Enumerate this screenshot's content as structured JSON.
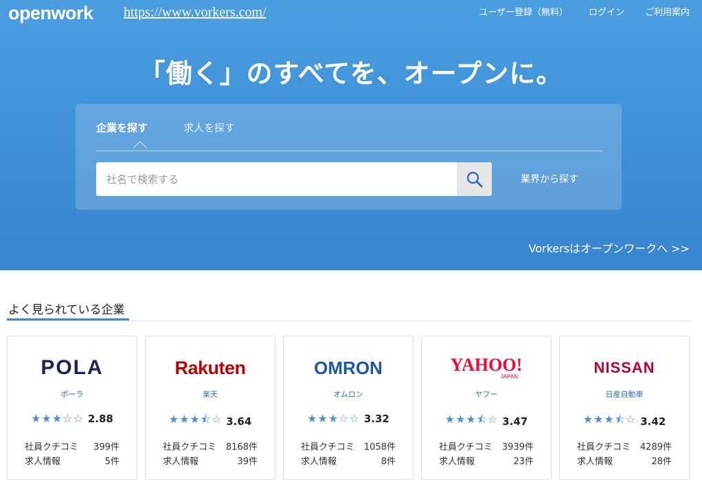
{
  "header": {
    "logo": "openwork",
    "url": "https://www.vorkers.com/",
    "nav": [
      "ユーザー登録（無料）",
      "ログイン",
      "ご利用案内"
    ]
  },
  "hero": {
    "headline": "「働く」のすべてを、オープンに。",
    "tabs": [
      "企業を探す",
      "求人を探す"
    ],
    "search_placeholder": "社名で検索する",
    "industry_link": "業界から探す",
    "vorkers_link": "Vorkersはオープンワークへ >>"
  },
  "section": {
    "title": "よく見られている企業"
  },
  "labels": {
    "reviews": "社員クチコミ",
    "jobs": "求人情報"
  },
  "companies": [
    {
      "logo": "POLA",
      "name": "ポーラ",
      "stars": "★★★☆☆",
      "score": "2.88",
      "reviews": "399件",
      "jobs": "5件"
    },
    {
      "logo": "Rakuten",
      "name": "楽天",
      "stars": "★★★⯪☆",
      "score": "3.64",
      "reviews": "8168件",
      "jobs": "39件"
    },
    {
      "logo": "OMRON",
      "name": "オムロン",
      "stars": "★★★☆☆",
      "score": "3.32",
      "reviews": "1058件",
      "jobs": "8件"
    },
    {
      "logo": "YAHOO!",
      "logo_sub": "JAPAN",
      "name": "ヤフー",
      "stars": "★★★⯪☆",
      "score": "3.47",
      "reviews": "3939件",
      "jobs": "23件"
    },
    {
      "logo": "NISSAN",
      "name": "日産自動車",
      "stars": "★★★⯪☆",
      "score": "3.42",
      "reviews": "4289件",
      "jobs": "28件"
    }
  ],
  "colors": {
    "hero": "#4a9ee0",
    "accent": "#3c8ad3",
    "pola": "#1a2456",
    "rakuten": "#bf0000",
    "omron": "#1e56a8",
    "yahoo": "#ff0033",
    "nissan": "#c3002f"
  }
}
